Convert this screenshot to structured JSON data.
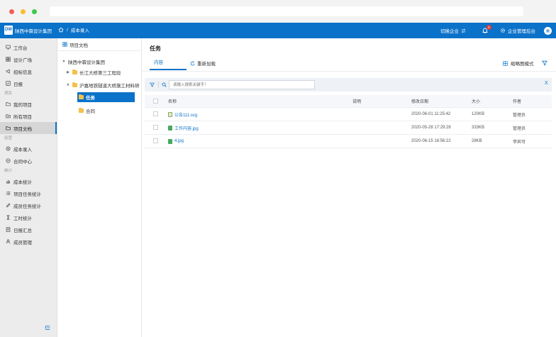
{
  "header": {
    "logo_text": "DW",
    "org_name": "陕西中霖设计集团",
    "breadcrumb_sep": "/",
    "breadcrumb_current": "成本录入",
    "switch_company": "切换企业",
    "notification_count": "5",
    "admin_label": "企业管理后台"
  },
  "sidebar": {
    "items_top": [
      {
        "label": "工作台",
        "icon": "monitor-icon"
      },
      {
        "label": "设计广场",
        "icon": "grid-icon"
      },
      {
        "label": "招标信息",
        "icon": "megaphone-icon"
      },
      {
        "label": "日报",
        "icon": "check-box-icon"
      }
    ],
    "group_project": "项目",
    "items_project": [
      {
        "label": "我的项目",
        "icon": "folder-user-icon"
      },
      {
        "label": "所有项目",
        "icon": "folder-icon"
      },
      {
        "label": "项目文档",
        "icon": "document-folder-icon"
      }
    ],
    "group_business": "经营",
    "items_business": [
      {
        "label": "成本录入",
        "icon": "cost-entry-icon"
      },
      {
        "label": "合同中心",
        "icon": "contract-icon"
      }
    ],
    "group_stats": "统计",
    "items_stats": [
      {
        "label": "成本统计",
        "icon": "bar-chart-icon"
      },
      {
        "label": "项目任务统计",
        "icon": "list-icon"
      },
      {
        "label": "成员任务统计",
        "icon": "pencil-icon"
      },
      {
        "label": "工时统计",
        "icon": "hourglass-icon"
      },
      {
        "label": "日报汇总",
        "icon": "report-icon"
      },
      {
        "label": "成员管理",
        "icon": "users-icon"
      }
    ]
  },
  "tree": {
    "header": "项目文档",
    "root": "陕西中霖设计集团",
    "nodes": [
      {
        "label": "长江大桥第三工程段"
      },
      {
        "label": "沪嘉地铁隧道大桥施工材料研"
      },
      {
        "label": "任务"
      },
      {
        "label": "合同"
      }
    ]
  },
  "main": {
    "title": "任务",
    "tab_content": "内容",
    "reload": "重新加载",
    "thumbnail_mode": "缩略图模式",
    "search_placeholder": "请输入搜索关键字！",
    "close": "X",
    "columns": {
      "name": "名称",
      "desc": "说明",
      "date": "修改日期",
      "size": "大小",
      "author": "作者"
    },
    "rows": [
      {
        "name": "公告111.svg",
        "desc": "",
        "date": "2020-06-01 11:25:42",
        "size": "120KB",
        "author": "管理员",
        "type": "svg"
      },
      {
        "name": "工作内容.jpg",
        "desc": "",
        "date": "2020-05-28 17:29:28",
        "size": "333KB",
        "author": "管理员",
        "type": "jpg"
      },
      {
        "name": "4.jpg",
        "desc": "",
        "date": "2020-06-15 16:56:22",
        "size": "28KB",
        "author": "李宾可",
        "type": "jpg"
      }
    ]
  },
  "colors": {
    "brand": "#0b72c9",
    "folder": "#f5c04a",
    "badge": "#e53935"
  }
}
